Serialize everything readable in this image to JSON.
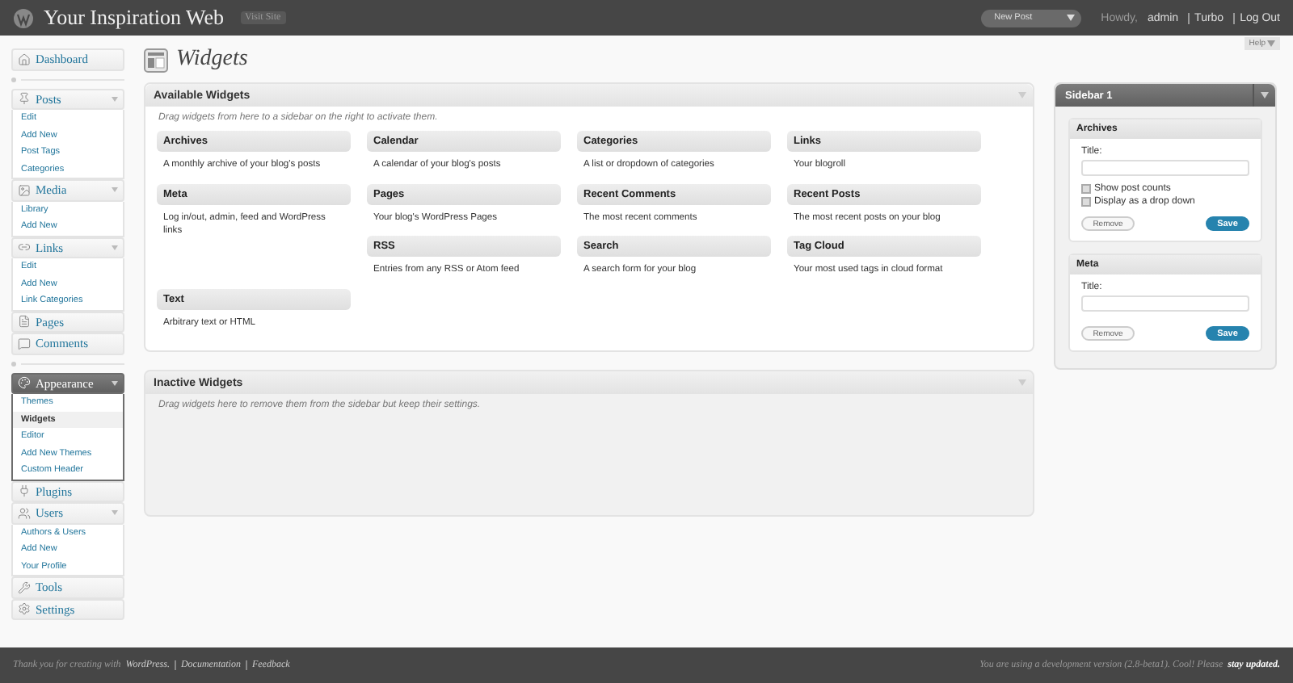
{
  "header": {
    "site_title": "Your Inspiration Web",
    "visit_site": "Visit Site",
    "new_post": "New Post",
    "howdy": "Howdy,",
    "user": "admin",
    "links": [
      "Turbo",
      "Log Out"
    ]
  },
  "help": "Help",
  "menu": [
    {
      "kind": "item",
      "label": "Dashboard",
      "current": false
    },
    {
      "kind": "separator"
    },
    {
      "kind": "item",
      "label": "Posts",
      "current": false,
      "expanded": true,
      "children": [
        {
          "label": "Edit",
          "selected": false
        },
        {
          "label": "Add New",
          "selected": false
        },
        {
          "label": "Post Tags",
          "selected": false
        },
        {
          "label": "Categories",
          "selected": false
        }
      ]
    },
    {
      "kind": "item",
      "label": "Media",
      "current": false,
      "expanded": true,
      "children": [
        {
          "label": "Library",
          "selected": false
        },
        {
          "label": "Add New",
          "selected": false
        }
      ]
    },
    {
      "kind": "item",
      "label": "Links",
      "current": false,
      "expanded": true,
      "children": [
        {
          "label": "Edit",
          "selected": false
        },
        {
          "label": "Add New",
          "selected": false
        },
        {
          "label": "Link Categories",
          "selected": false
        }
      ]
    },
    {
      "kind": "item",
      "label": "Pages",
      "current": false
    },
    {
      "kind": "item",
      "label": "Comments",
      "current": false
    },
    {
      "kind": "separator"
    },
    {
      "kind": "item",
      "label": "Appearance",
      "current": true,
      "expanded": true,
      "children": [
        {
          "label": "Themes",
          "selected": false
        },
        {
          "label": "Widgets",
          "selected": true
        },
        {
          "label": "Editor",
          "selected": false
        },
        {
          "label": "Add New Themes",
          "selected": false
        },
        {
          "label": "Custom Header",
          "selected": false
        }
      ]
    },
    {
      "kind": "item",
      "label": "Plugins",
      "current": false
    },
    {
      "kind": "item",
      "label": "Users",
      "current": false,
      "expanded": true,
      "children": [
        {
          "label": "Authors & Users",
          "selected": false
        },
        {
          "label": "Add New",
          "selected": false
        },
        {
          "label": "Your Profile",
          "selected": false
        }
      ]
    },
    {
      "kind": "item",
      "label": "Tools",
      "current": false
    },
    {
      "kind": "item",
      "label": "Settings",
      "current": false
    }
  ],
  "page_title": "Widgets",
  "available": {
    "title": "Available Widgets",
    "hint": "Drag widgets from here to a sidebar on the right to activate them.",
    "widgets": [
      {
        "name": "Archives",
        "description": "A monthly archive of your blog's posts"
      },
      {
        "name": "Calendar",
        "description": "A calendar of your blog's posts"
      },
      {
        "name": "Categories",
        "description": "A list or dropdown of categories"
      },
      {
        "name": "Links",
        "description": "Your blogroll"
      },
      {
        "name": "Meta",
        "description": "Log in/out, admin, feed and WordPress links"
      },
      {
        "name": "Pages",
        "description": "Your blog's WordPress Pages"
      },
      {
        "name": "Recent Comments",
        "description": "The most recent comments"
      },
      {
        "name": "Recent Posts",
        "description": "The most recent posts on your blog"
      },
      {
        "name": "RSS",
        "description": "Entries from any RSS or Atom feed"
      },
      {
        "name": "Search",
        "description": "A search form for your blog"
      },
      {
        "name": "Tag Cloud",
        "description": "Your most used tags in cloud format"
      },
      {
        "name": "Text",
        "description": "Arbitrary text or HTML"
      }
    ]
  },
  "inactive": {
    "title": "Inactive Widgets",
    "hint": "Drag widgets here to remove them from the sidebar but keep their settings."
  },
  "sidebar": {
    "title": "Sidebar 1",
    "widgets": [
      {
        "title": "Archives",
        "field_label": "Title:",
        "checkboxes": [
          {
            "label": "Show post counts",
            "checked": false
          },
          {
            "label": "Display as a drop down",
            "checked": false
          }
        ],
        "remove": "Remove",
        "save": "Save"
      },
      {
        "title": "Meta",
        "field_label": "Title:",
        "remove": "Remove",
        "save": "Save"
      }
    ]
  },
  "footer": {
    "thanks": "Thank you for creating with",
    "wordpress": "WordPress.",
    "links": [
      "Documentation",
      "Feedback"
    ],
    "version": "You are using a development version (2.8-beta1). Cool! Please",
    "update": "stay updated."
  }
}
